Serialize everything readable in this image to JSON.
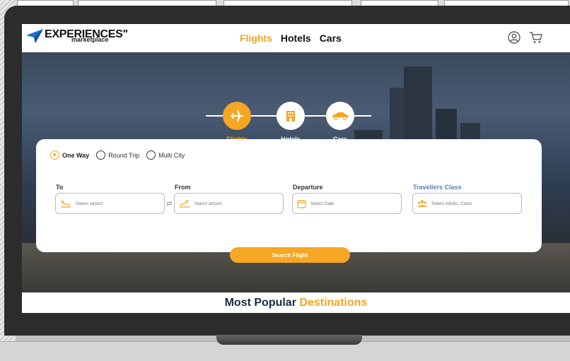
{
  "header": {
    "logo_text": "EXPERIENCES\"",
    "logo_sub": "marketplace",
    "nav": [
      {
        "label": "Flights",
        "active": true
      },
      {
        "label": "Hotels",
        "active": false
      },
      {
        "label": "Cars",
        "active": false
      }
    ],
    "icons": [
      "user-icon",
      "cart-icon"
    ]
  },
  "steps": [
    {
      "label": "Flights",
      "icon": "plane-icon",
      "active": true
    },
    {
      "label": "Hotels",
      "icon": "hotel-icon",
      "active": false
    },
    {
      "label": "Cars",
      "icon": "car-icon",
      "active": false
    }
  ],
  "search": {
    "trip_types": [
      {
        "label": "One Way",
        "selected": true
      },
      {
        "label": "Round Trip",
        "selected": false
      },
      {
        "label": "Multi City",
        "selected": false
      }
    ],
    "to": {
      "label": "To",
      "placeholder": "Select airport"
    },
    "from": {
      "label": "From",
      "placeholder": "Select airport"
    },
    "departure": {
      "label": "Departure",
      "placeholder": "Select Date"
    },
    "travellers": {
      "label": "Travellers Class",
      "placeholder": "Select Adults, Class"
    },
    "button": "Search Flight"
  },
  "popular": {
    "prefix": "Most Popular",
    "highlight": "Destinations"
  },
  "colors": {
    "accent": "#f5a623",
    "label_blue": "#5a7fb0"
  }
}
